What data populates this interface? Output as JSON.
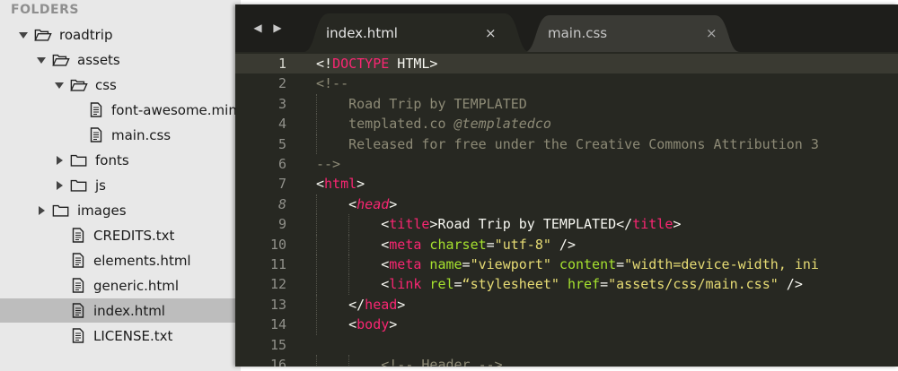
{
  "sidebar": {
    "header": "FOLDERS",
    "items": [
      {
        "label": "roadtrip",
        "type": "folder",
        "depth": 0,
        "state": "open"
      },
      {
        "label": "assets",
        "type": "folder",
        "depth": 1,
        "state": "open"
      },
      {
        "label": "css",
        "type": "folder",
        "depth": 2,
        "state": "open"
      },
      {
        "label": "font-awesome.min",
        "type": "file",
        "depth": 3
      },
      {
        "label": "main.css",
        "type": "file",
        "depth": 3
      },
      {
        "label": "fonts",
        "type": "folder",
        "depth": 2,
        "state": "closed"
      },
      {
        "label": "js",
        "type": "folder",
        "depth": 2,
        "state": "closed"
      },
      {
        "label": "images",
        "type": "folder",
        "depth": 1,
        "state": "closed"
      },
      {
        "label": "CREDITS.txt",
        "type": "file",
        "depth": 2
      },
      {
        "label": "elements.html",
        "type": "file",
        "depth": 2
      },
      {
        "label": "generic.html",
        "type": "file",
        "depth": 2
      },
      {
        "label": "index.html",
        "type": "file",
        "depth": 2,
        "selected": true
      },
      {
        "label": "LICENSE.txt",
        "type": "file",
        "depth": 2
      }
    ]
  },
  "tabs": {
    "nav_back": "◀",
    "nav_forward": "▶",
    "items": [
      {
        "title": "index.html",
        "close": "×",
        "active": true
      },
      {
        "title": "main.css",
        "close": "×",
        "active": false
      }
    ]
  },
  "colors": {
    "editor_bg": "#272822",
    "tag": "#f92672",
    "attribute": "#a6e22e",
    "string": "#e6db74",
    "comment": "#8d8a76",
    "text": "#f8f8f2"
  },
  "code": {
    "active_line": 1,
    "lines": [
      {
        "n": "1",
        "tokens": [
          [
            "pun",
            "<!"
          ],
          [
            "tag",
            "DOCTYPE"
          ],
          [
            "txt",
            " HTML>"
          ]
        ]
      },
      {
        "n": "2",
        "tokens": [
          [
            "cmt",
            "<!--"
          ]
        ]
      },
      {
        "n": "3",
        "indent": 2,
        "tokens": [
          [
            "cmt",
            "Road Trip by TEMPLATED"
          ]
        ]
      },
      {
        "n": "4",
        "indent": 2,
        "tokens": [
          [
            "cmt",
            "templated.co "
          ],
          [
            "cmti",
            "@templatedco"
          ]
        ]
      },
      {
        "n": "5",
        "indent": 2,
        "tokens": [
          [
            "cmt",
            "Released for free under the Creative Commons Attribution 3"
          ]
        ]
      },
      {
        "n": "6",
        "tokens": [
          [
            "cmt",
            "-->"
          ]
        ]
      },
      {
        "n": "7",
        "tokens": [
          [
            "pun",
            "<"
          ],
          [
            "tag",
            "html"
          ],
          [
            "pun",
            ">"
          ]
        ]
      },
      {
        "n": "8",
        "italic": true,
        "indent": 2,
        "tokens": [
          [
            "pun",
            "<"
          ],
          [
            "tagi",
            "head"
          ],
          [
            "pun",
            ">"
          ]
        ]
      },
      {
        "n": "9",
        "indent": 4,
        "tokens": [
          [
            "pun",
            "<"
          ],
          [
            "tag",
            "title"
          ],
          [
            "pun",
            ">"
          ],
          [
            "txt",
            "Road Trip by TEMPLATED"
          ],
          [
            "pun",
            "</"
          ],
          [
            "tag",
            "title"
          ],
          [
            "pun",
            ">"
          ]
        ]
      },
      {
        "n": "10",
        "indent": 4,
        "tokens": [
          [
            "pun",
            "<"
          ],
          [
            "tag",
            "meta"
          ],
          [
            "txt",
            " "
          ],
          [
            "attr",
            "charset"
          ],
          [
            "pun",
            "="
          ],
          [
            "str",
            "\"utf-8\""
          ],
          [
            "pun",
            " />"
          ]
        ]
      },
      {
        "n": "11",
        "indent": 4,
        "tokens": [
          [
            "pun",
            "<"
          ],
          [
            "tag",
            "meta"
          ],
          [
            "txt",
            " "
          ],
          [
            "attr",
            "name"
          ],
          [
            "pun",
            "="
          ],
          [
            "str",
            "\"viewport\""
          ],
          [
            "txt",
            " "
          ],
          [
            "attr",
            "content"
          ],
          [
            "pun",
            "="
          ],
          [
            "str",
            "\"width=device-width, ini"
          ]
        ]
      },
      {
        "n": "12",
        "indent": 4,
        "tokens": [
          [
            "pun",
            "<"
          ],
          [
            "tag",
            "link"
          ],
          [
            "txt",
            " "
          ],
          [
            "attr",
            "rel"
          ],
          [
            "pun",
            "="
          ],
          [
            "str",
            "“stylesheet\""
          ],
          [
            "txt",
            " "
          ],
          [
            "attr",
            "href"
          ],
          [
            "pun",
            "="
          ],
          [
            "str",
            "\"assets/css/main.css\""
          ],
          [
            "pun",
            " />"
          ]
        ]
      },
      {
        "n": "13",
        "indent": 2,
        "tokens": [
          [
            "pun",
            "</"
          ],
          [
            "tag",
            "head"
          ],
          [
            "pun",
            ">"
          ]
        ]
      },
      {
        "n": "14",
        "indent": 2,
        "tokens": [
          [
            "pun",
            "<"
          ],
          [
            "tag",
            "body"
          ],
          [
            "pun",
            ">"
          ]
        ]
      },
      {
        "n": "15",
        "tokens": []
      },
      {
        "n": "16",
        "indent": 4,
        "tokens": [
          [
            "cmt",
            "<!-- Header -->"
          ]
        ]
      }
    ]
  }
}
